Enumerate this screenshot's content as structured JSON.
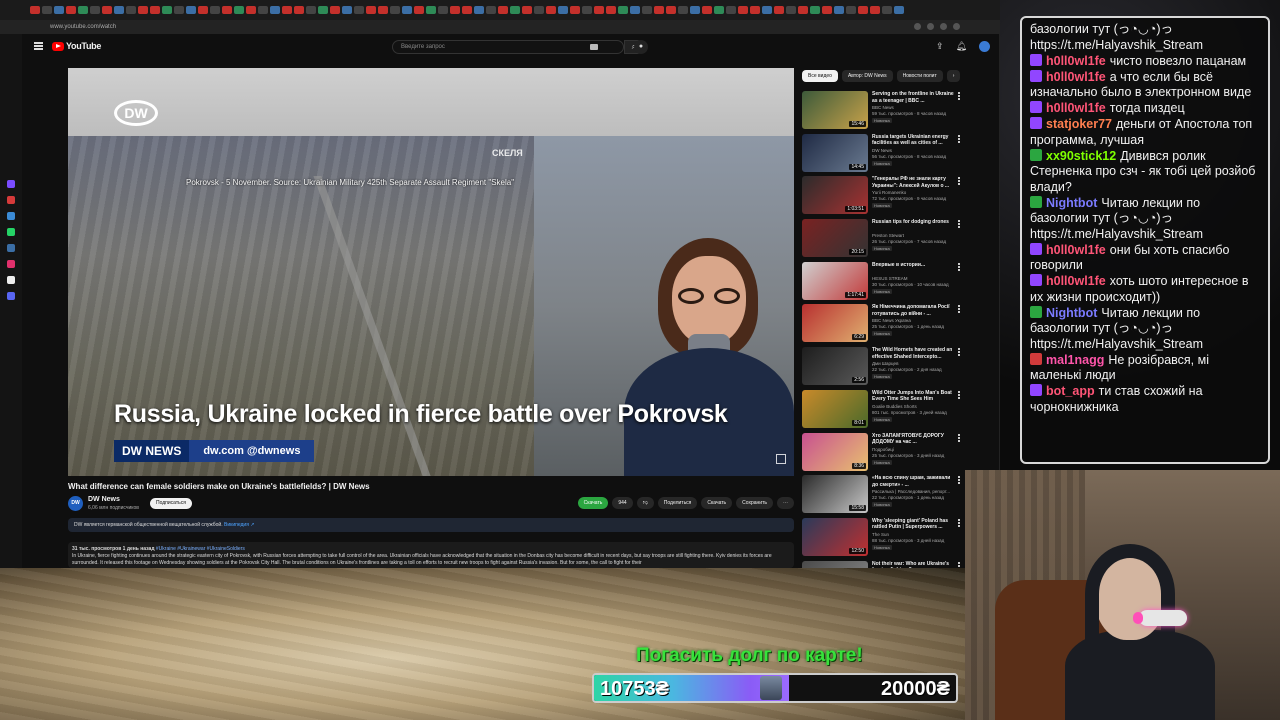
{
  "browser": {
    "url": "www.youtube.com/watch"
  },
  "youtube": {
    "logo_text": "YouTube",
    "search_placeholder": "Введите запрос",
    "video": {
      "location_caption": "Pokrovsk - 5 November. Source: Ukrainian Military 425th Separate Assault Regiment \"Skela\"",
      "watermark": "СКЕЛЯ",
      "logo": "DW",
      "headline": "Russia, Ukraine locked in fierce battle over Pokrovsk",
      "news_tag": "DW NEWS",
      "news_site": "dw.com @dwnews"
    },
    "title": "What difference can female soldiers make on Ukraine's battlefields? | DW News",
    "channel": {
      "name": "DW News",
      "subs": "6,06 млн подписчиков",
      "subscribe": "Подписаться"
    },
    "actions": {
      "download_ext": "Скачать",
      "likes": "944",
      "share": "Поделиться",
      "download": "Скачать",
      "save": "Сохранить"
    },
    "notice": {
      "text": "DW является германской общественной вещательной службой.",
      "link": "Википедия ↗"
    },
    "description": {
      "meta": "31 тыс. просмотров  1 день назад",
      "tags": "#Ukraine #Ukrainewar #UkraineSoldiers",
      "text": "In Ukraine, fierce fighting continues around the strategic eastern city of Pokrovsk, with Russian forces attempting to take full control of the area. Ukrainian officials have acknowledged that the situation in the Donbas city has become difficult in recent days, but say troops are still fighting there. Kyiv denies its forces are surrounded. It released this footage on Wednesday showing soldiers at the Pokrovsk City Hall. The brutal conditions on Ukraine's frontlines are taking a toll on efforts to recruit new troops to fight against Russia's invasion. But for some, the call to fight for their"
    },
    "chips": [
      "Все видео",
      "Автор: DW News",
      "Новости полит"
    ],
    "related": [
      {
        "title": "Serving on the frontline in Ukraine as a teenager | BBC ...",
        "channel": "BBC News",
        "meta": "59 тыс. просмотров · 8 часов назад",
        "badge": "Новинка",
        "dur": "15:46",
        "c1": "#3c5a3a",
        "c2": "#c8a24a"
      },
      {
        "title": "Russia targets Ukrainian energy facilities as well as cities of ...",
        "channel": "DW News",
        "meta": "56 тыс. просмотров · 8 часов назад",
        "badge": "Новинка",
        "dur": "14:45",
        "c1": "#1f2a44",
        "c2": "#6a7a90"
      },
      {
        "title": "\"Генералы РФ не знали карту Украины\": Алексей Акулов о ...",
        "channel": "Yurii Romanenko",
        "meta": "72 тыс. просмотров · 9 часов назад",
        "badge": "Новинка",
        "dur": "1:03:51",
        "c1": "#2b2b2b",
        "c2": "#a83232"
      },
      {
        "title": "Russian tips for dodging drones",
        "channel": "Preston Stewart",
        "meta": "26 тыс. просмотров · 7 часов назад",
        "badge": "Новинка",
        "dur": "20:15",
        "c1": "#7a2222",
        "c2": "#333333"
      },
      {
        "title": "Впервые в истории...",
        "channel": "HESUS STREAM",
        "meta": "30 тыс. просмотров · 10 часов назад",
        "badge": "Новинка",
        "dur": "1:17:41",
        "c1": "#d0d0d0",
        "c2": "#c23a3a"
      },
      {
        "title": "Як Німеччина допомагала Росії готуватись до війни - ...",
        "channel": "BBC News Україна",
        "meta": "25 тыс. просмотров · 1 день назад",
        "badge": "Новинка",
        "dur": "6:29",
        "c1": "#b83030",
        "c2": "#e0b070"
      },
      {
        "title": "The Wild Hornets have created an effective Shahed Intercepto...",
        "channel": "Дми Шарцев",
        "meta": "22 тыс. просмотров · 2 дня назад",
        "badge": "Новинка",
        "dur": "2:56",
        "c1": "#1d1d1d",
        "c2": "#5a5a5a"
      },
      {
        "title": "Wild Otter Jumps Into Man's Boat Every Time She Sees Him",
        "channel": "Goalie Buddies Shorts",
        "meta": "801 тыс. просмотров · 3 дней назад",
        "badge": "Новинка",
        "dur": "8:01",
        "c1": "#c98a2a",
        "c2": "#4a6a2a"
      },
      {
        "title": "Хто ЗАПАМ'ЯТОВУЄ ДОРОГУ ДОДОМУ на час ...",
        "channel": "Подробиці",
        "meta": "25 тыс. просмотров · 3 дней назад",
        "badge": "Новинка",
        "dur": "8:36",
        "c1": "#c85090",
        "c2": "#e8c070"
      },
      {
        "title": "«На всю спину шрам, заживали до смерти» - ...",
        "channel": "Рассилька | Расследования, репорт...",
        "meta": "22 тыс. просмотров · 1 день назад",
        "badge": "Новинка",
        "dur": "15:58",
        "c1": "#2a2a2a",
        "c2": "#c8c8c8"
      },
      {
        "title": "Why 'sleeping giant' Poland has rattled Putin | Superpowers ...",
        "channel": "The Sun",
        "meta": "88 тыс. просмотров · 3 дней назад",
        "badge": "Новинка",
        "dur": "12:50",
        "c1": "#2a3a5a",
        "c2": "#c03030"
      },
      {
        "title": "Not their war: Who are Ukraine's foreign fighters?",
        "channel": "",
        "meta": "",
        "badge": "",
        "dur": "",
        "c1": "#4a4a4a",
        "c2": "#8a8a8a"
      }
    ]
  },
  "chat": [
    {
      "user": "",
      "text": "базологии тут (っ◔◡◔)っ https://t.me/Halyavshik_Stream",
      "color": "#f2f2f2",
      "badge": ""
    },
    {
      "user": "h0ll0wl1fe",
      "text": "чисто повезло пацанам",
      "color": "#ff5577",
      "badge": "purple"
    },
    {
      "user": "h0ll0wl1fe",
      "text": "а что если бы всё изначально было в электронном виде",
      "color": "#ff5577",
      "badge": "purple"
    },
    {
      "user": "h0ll0wl1fe",
      "text": "тогда пиздец",
      "color": "#ff5577",
      "badge": "purple"
    },
    {
      "user": "statjoker77",
      "text": "деньги от Апостола топ программа, лучшая",
      "color": "#ff7f50",
      "badge": "purple"
    },
    {
      "user": "xx90stick12",
      "text": "Дивився ролик Стерненка про сзч - як тобі цей розйоб влади?",
      "color": "#7fff00",
      "badge": "green"
    },
    {
      "user": "Nightbot",
      "text": "Читаю лекции по базологии тут (っ◔◡◔)っ https://t.me/Halyavshik_Stream",
      "color": "#7b7bff",
      "badge": "green"
    },
    {
      "user": "h0ll0wl1fe",
      "text": "они бы хоть спасибо говорили",
      "color": "#ff5577",
      "badge": "purple"
    },
    {
      "user": "h0ll0wl1fe",
      "text": "хоть шото интересное в их жизни происходит))",
      "color": "#ff5577",
      "badge": "purple"
    },
    {
      "user": "Nightbot",
      "text": "Читаю лекции по базологии тут (っ◔◡◔)っ https://t.me/Halyavshik_Stream",
      "color": "#7b7bff",
      "badge": "green"
    },
    {
      "user": "mal1nagg",
      "text": "Не розібрався, мі маленькі люди",
      "color": "#ff55aa",
      "badge": "red"
    },
    {
      "user": "bot_app",
      "text": "ти став схожий на чорнокнижника",
      "color": "#ff5577",
      "badge": "purple"
    }
  ],
  "goal": {
    "title": "Погасить долг по карте!",
    "current": "10753₴",
    "target": "20000₴",
    "progress_fraction": 0.5377
  }
}
